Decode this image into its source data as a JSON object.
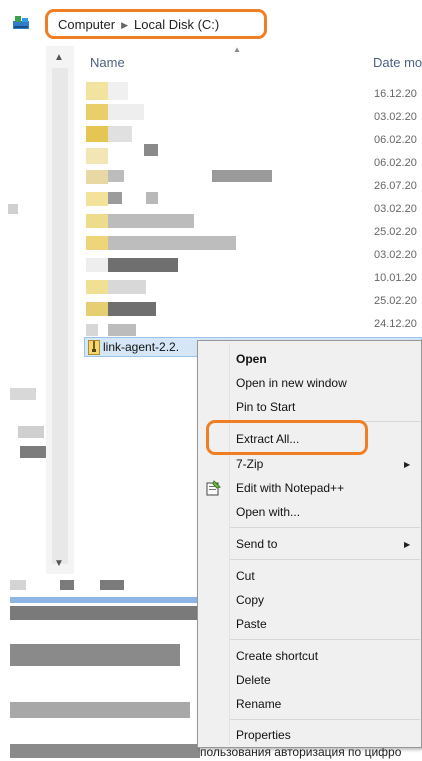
{
  "address_bar": {
    "crumbs": [
      "Computer",
      "Local Disk (C:)"
    ],
    "highlight_color": "#f07e23"
  },
  "columns": {
    "name": "Name",
    "date": "Date mo"
  },
  "rows": {
    "dates": [
      "16.12.20",
      "03.02.20",
      "06.02.20",
      "06.02.20",
      "26.07.20",
      "03.02.20",
      "25.02.20",
      "03.02.20",
      "10.01.20",
      "25.02.20",
      "24.12.20"
    ],
    "selected_file": "link-agent-2.2."
  },
  "context_menu": {
    "items": [
      {
        "label": "Open",
        "bold": true
      },
      {
        "label": "Open in new window"
      },
      {
        "label": "Pin to Start"
      },
      {
        "label": "Extract All..."
      },
      {
        "label": "7-Zip",
        "submenu": true
      },
      {
        "label": "Edit with Notepad++",
        "icon": "notepad-plus-plus-icon"
      },
      {
        "label": "Open with..."
      },
      {
        "label": "Send to",
        "submenu": true
      },
      {
        "label": "Cut"
      },
      {
        "label": "Copy"
      },
      {
        "label": "Paste"
      },
      {
        "label": "Create shortcut"
      },
      {
        "label": "Delete"
      },
      {
        "label": "Rename"
      },
      {
        "label": "Properties"
      }
    ]
  },
  "bottom_text": "пользования авторизация по цифро"
}
